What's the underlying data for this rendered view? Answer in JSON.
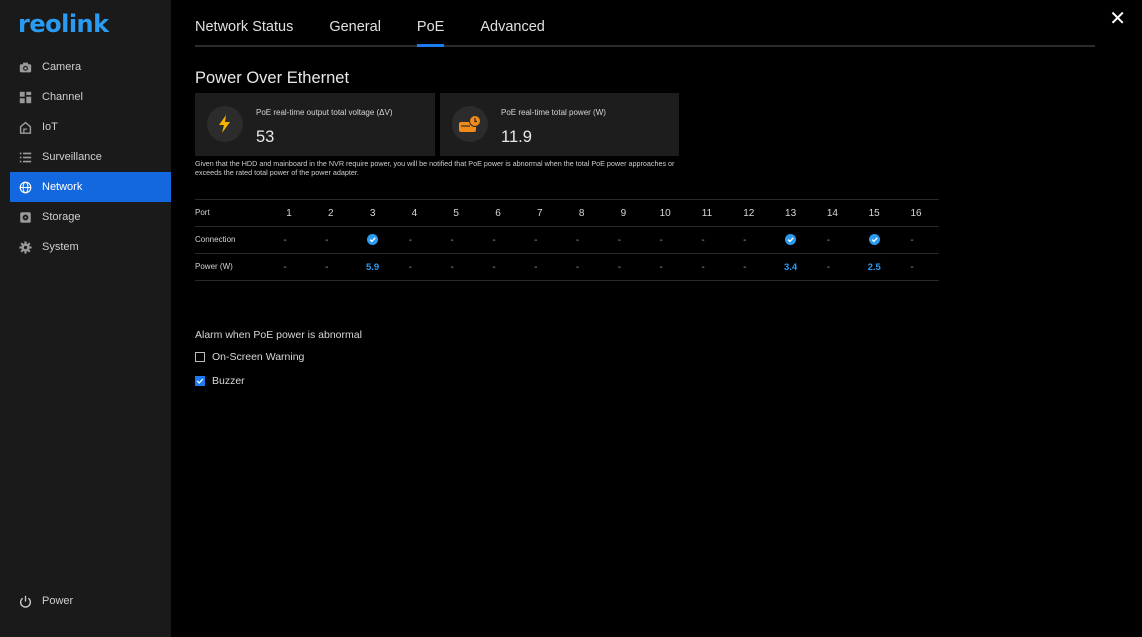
{
  "brand": {
    "logo_text": "reolink",
    "accent": "#1368e0",
    "logo_color": "#2a9bf0"
  },
  "sidebar": {
    "items": [
      {
        "label": "Camera",
        "icon": "camera-icon",
        "active": false
      },
      {
        "label": "Channel",
        "icon": "grid-icon",
        "active": false
      },
      {
        "label": "IoT",
        "icon": "home-icon",
        "active": false
      },
      {
        "label": "Surveillance",
        "icon": "list-icon",
        "active": false
      },
      {
        "label": "Network",
        "icon": "globe-icon",
        "active": true
      },
      {
        "label": "Storage",
        "icon": "storage-icon",
        "active": false
      },
      {
        "label": "System",
        "icon": "gear-icon",
        "active": false
      }
    ],
    "power_label": "Power"
  },
  "tabs": [
    {
      "label": "Network Status",
      "active": false
    },
    {
      "label": "General",
      "active": false
    },
    {
      "label": "PoE",
      "active": true
    },
    {
      "label": "Advanced",
      "active": false
    }
  ],
  "section_title": "Power Over Ethernet",
  "cards": {
    "voltage": {
      "label": "PoE real-time output total voltage (ΔV)",
      "value": "53",
      "icon": "bolt-icon"
    },
    "power": {
      "label": "PoE real-time total power (W)",
      "value": "11.9",
      "icon": "power-adapter-icon"
    }
  },
  "note": "Given that the HDD and mainboard in the NVR require power, you will be notified that PoE power is abnormal when the total PoE power approaches or exceeds the rated total power of the power adapter.",
  "ports_table": {
    "row_labels": {
      "port": "Port",
      "connection": "Connection",
      "power": "Power (W)"
    },
    "ports": [
      "1",
      "2",
      "3",
      "4",
      "5",
      "6",
      "7",
      "8",
      "9",
      "10",
      "11",
      "12",
      "13",
      "14",
      "15",
      "16"
    ],
    "connection": [
      "-",
      "-",
      "connected",
      "-",
      "-",
      "-",
      "-",
      "-",
      "-",
      "-",
      "-",
      "-",
      "connected",
      "-",
      "connected",
      "-"
    ],
    "power": [
      "-",
      "-",
      "5.9",
      "-",
      "-",
      "-",
      "-",
      "-",
      "-",
      "-",
      "-",
      "-",
      "3.4",
      "-",
      "2.5",
      "-"
    ]
  },
  "alarm": {
    "title": "Alarm when PoE power is abnormal",
    "options": [
      {
        "label": "On-Screen Warning",
        "checked": false
      },
      {
        "label": "Buzzer",
        "checked": true
      }
    ]
  }
}
